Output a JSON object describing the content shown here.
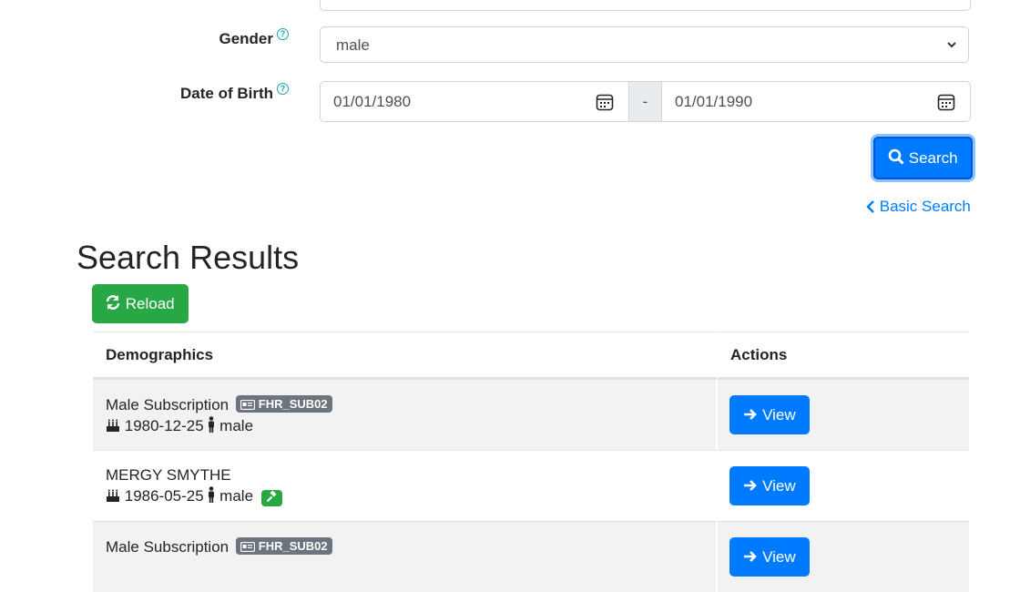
{
  "form": {
    "gender_label": "Gender",
    "gender_value": "male",
    "dob_label": "Date of Birth",
    "dob_from": "01/01/1980",
    "dob_separator": "-",
    "dob_to": "01/01/1990",
    "help_glyph": "?",
    "search_label": "Search",
    "basic_search_label": "Basic Search"
  },
  "results": {
    "heading": "Search Results",
    "reload_label": "Reload",
    "columns": {
      "demographics": "Demographics",
      "actions": "Actions"
    },
    "rows": [
      {
        "name": "Male Subscription",
        "badge": "FHR_SUB02",
        "dob": "1980-12-25",
        "gender": "male",
        "view_label": "View",
        "extra_icon": null
      },
      {
        "name": "MERGY SMYTHE",
        "badge": null,
        "dob": "1986-05-25",
        "gender": "male",
        "view_label": "View",
        "extra_icon": "gavel-icon"
      },
      {
        "name": "Male Subscription",
        "badge": "FHR_SUB02",
        "dob": "",
        "gender": "",
        "view_label": "View",
        "extra_icon": null
      }
    ]
  },
  "colors": {
    "primary": "#007bff",
    "success": "#28a745",
    "secondary": "#6c757d",
    "info": "#17a2b8"
  }
}
